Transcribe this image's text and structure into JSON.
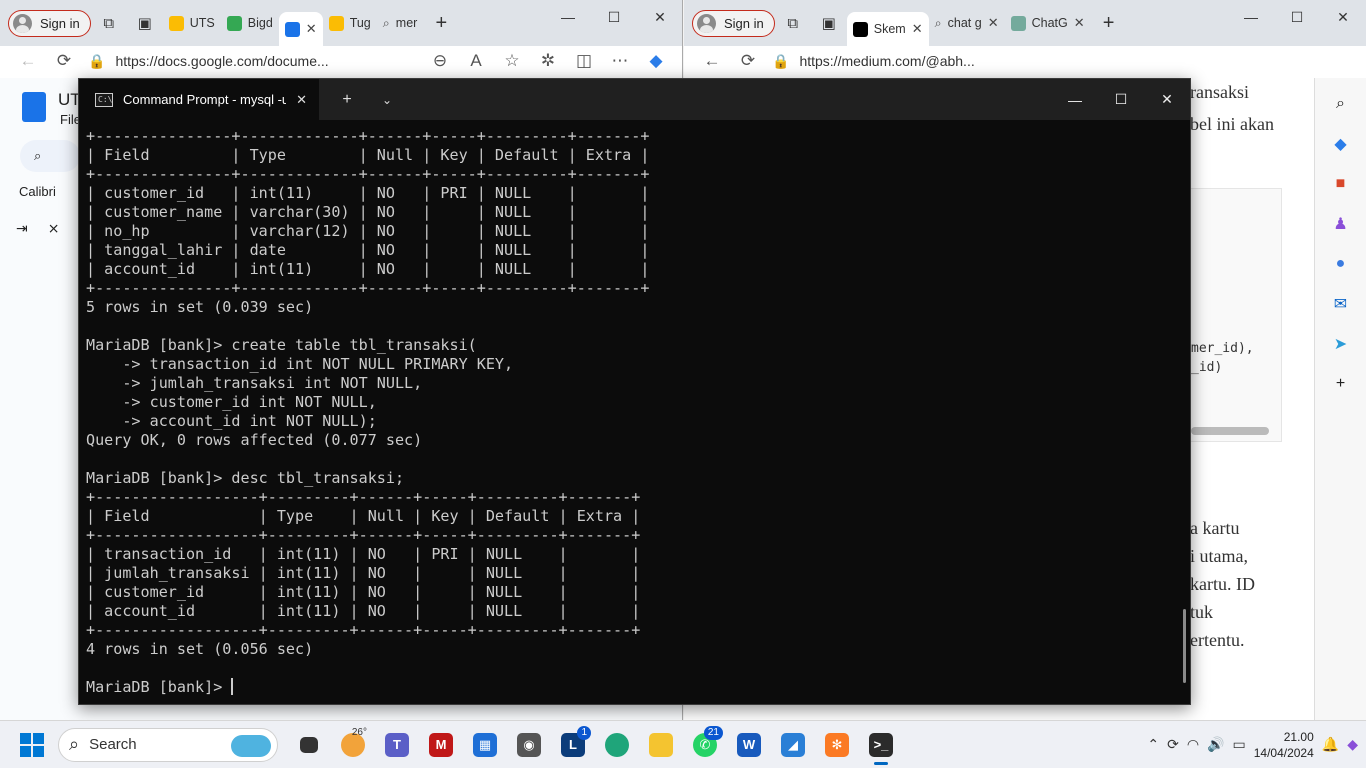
{
  "left_browser": {
    "signin": "Sign in",
    "tabs": [
      {
        "label": "UTS",
        "color": "#4285f4"
      },
      {
        "label": "Bigd",
        "color": "#4285f4"
      },
      {
        "label": "",
        "color": "#1a73e8"
      },
      {
        "label": "Tug",
        "color": "#4285f4"
      },
      {
        "label": "mer",
        "color": "#888888"
      }
    ],
    "url": "https://docs.google.com/docume...",
    "docs": {
      "title": "UT",
      "file_menu": "File",
      "font": "Calibri"
    }
  },
  "right_browser": {
    "signin": "Sign in",
    "tabs": [
      {
        "label": "Skem"
      },
      {
        "label": "chat g"
      },
      {
        "label": "ChatG"
      }
    ],
    "url": "https://medium.com/@abh...",
    "article_lines": [
      "ransaksi",
      "bel ini akan",
      "a kartu",
      "i utama,",
      "kartu. ID",
      "tuk",
      "ertentu."
    ],
    "code_lines": [
      "mer_id),",
      "_id)"
    ]
  },
  "terminal": {
    "tab_title": "Command Prompt - mysql -u",
    "lines": [
      "+---------------+-------------+------+-----+---------+-------+",
      "| Field         | Type        | Null | Key | Default | Extra |",
      "+---------------+-------------+------+-----+---------+-------+",
      "| customer_id   | int(11)     | NO   | PRI | NULL    |       |",
      "| customer_name | varchar(30) | NO   |     | NULL    |       |",
      "| no_hp         | varchar(12) | NO   |     | NULL    |       |",
      "| tanggal_lahir | date        | NO   |     | NULL    |       |",
      "| account_id    | int(11)     | NO   |     | NULL    |       |",
      "+---------------+-------------+------+-----+---------+-------+",
      "5 rows in set (0.039 sec)",
      "",
      "MariaDB [bank]> create table tbl_transaksi(",
      "    -> transaction_id int NOT NULL PRIMARY KEY,",
      "    -> jumlah_transaksi int NOT NULL,",
      "    -> customer_id int NOT NULL,",
      "    -> account_id int NOT NULL);",
      "Query OK, 0 rows affected (0.077 sec)",
      "",
      "MariaDB [bank]> desc tbl_transaksi;",
      "+------------------+---------+------+-----+---------+-------+",
      "| Field            | Type    | Null | Key | Default | Extra |",
      "+------------------+---------+------+-----+---------+-------+",
      "| transaction_id   | int(11) | NO   | PRI | NULL    |       |",
      "| jumlah_transaksi | int(11) | NO   |     | NULL    |       |",
      "| customer_id      | int(11) | NO   |     | NULL    |       |",
      "| account_id       | int(11) | NO   |     | NULL    |       |",
      "+------------------+---------+------+-----+---------+-------+",
      "4 rows in set (0.056 sec)",
      ""
    ],
    "prompt": "MariaDB [bank]> "
  },
  "taskbar": {
    "search": "Search",
    "weather_temp": "26°",
    "badge_l": "1",
    "badge_whatsapp": "21",
    "time": "21.00",
    "date": "14/04/2024"
  }
}
